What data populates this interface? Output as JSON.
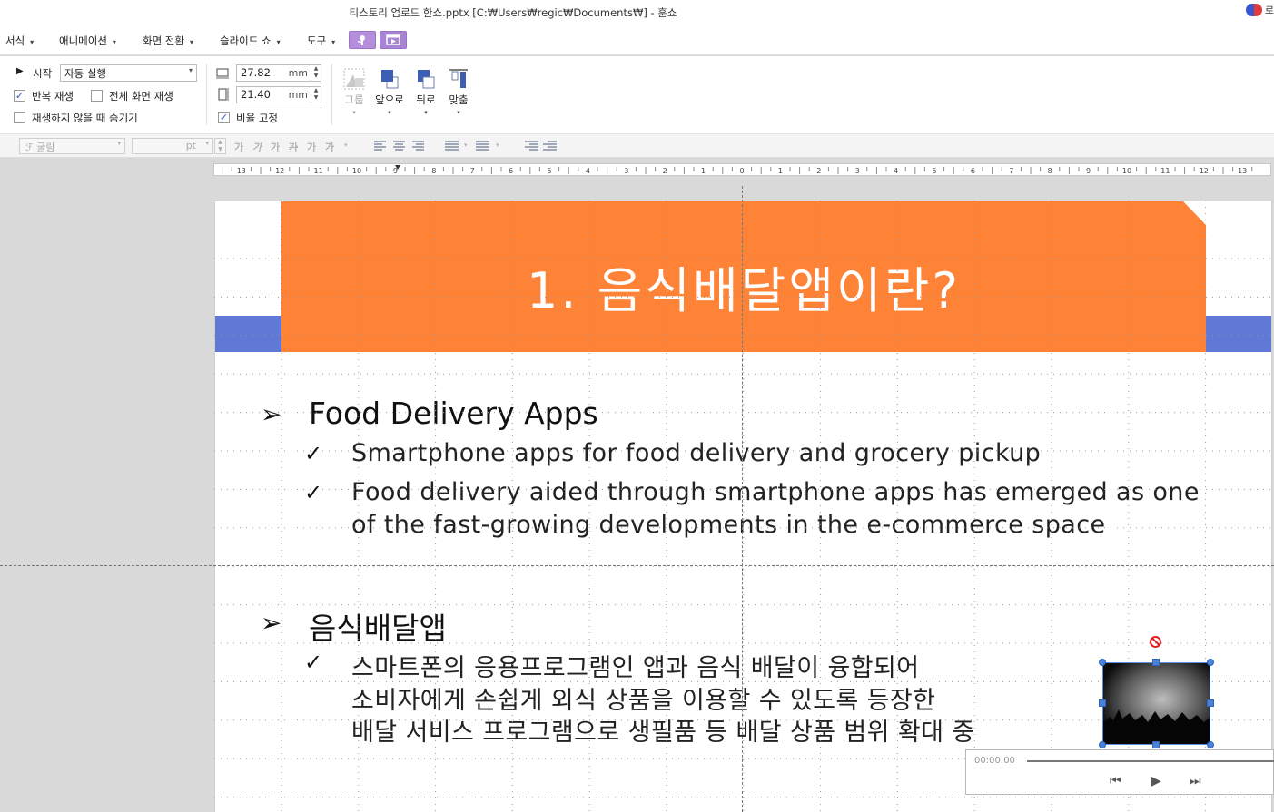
{
  "window": {
    "title": "티스토리 업로드 한쇼.pptx [C:₩Users₩regic₩Documents₩] - 훈쇼",
    "user_label": "로"
  },
  "menu": {
    "items": [
      "서식",
      "애니메이션",
      "화면 전환",
      "슬라이드 쇼",
      "도구"
    ]
  },
  "ribbon": {
    "start_label": "시작",
    "start_value": "자동 실행",
    "loop_label": "반복 재생",
    "loop_checked": true,
    "fullscreen_label": "전체 화면 재생",
    "fullscreen_checked": false,
    "hide_label": "재생하지 않을 때 숨기기",
    "hide_checked": false,
    "height_value": "27.82",
    "width_value": "21.40",
    "unit": "mm",
    "ratio_label": "비율 고정",
    "ratio_checked": true,
    "tools": {
      "group": "그룹",
      "front": "앞으로",
      "back": "뒤로",
      "fit": "맞춤"
    }
  },
  "formatbar": {
    "font_placeholder": "굴림",
    "size_unit": "pt",
    "glyphs": [
      "가",
      "가",
      "가",
      "가",
      "가",
      "가"
    ]
  },
  "ruler": {
    "left_ticks": [
      "13",
      "12",
      "11",
      "10",
      "9",
      "8",
      "7",
      "6",
      "5",
      "4",
      "3",
      "2",
      "1",
      "0"
    ],
    "right_ticks": [
      "1",
      "2",
      "3",
      "4",
      "5",
      "6",
      "7",
      "8",
      "9",
      "10",
      "11",
      "12",
      "13"
    ]
  },
  "slide": {
    "title": "1. 음식배달앱이란?",
    "section1": {
      "heading": "Food Delivery Apps",
      "bullets": [
        "Smartphone apps for food delivery and grocery pickup",
        "Food delivery aided through smartphone apps has emerged as one",
        "of the fast-growing developments in the e-commerce space"
      ]
    },
    "section2": {
      "heading": "음식배달앱",
      "bullets": [
        "스마트폰의 응용프로그램인 앱과 음식 배달이 융합되어",
        "소비자에게 손쉽게 외식 상품을 이용할 수 있도록 등장한",
        "배달 서비스 프로그램으로 생필품 등 배달 상품 범위 확대 중"
      ]
    },
    "bullet_glyph_arrow": "➢",
    "bullet_glyph_check": "✓"
  },
  "media": {
    "time": "00:00:00",
    "prev_glyph": "⏮",
    "play_glyph": "▶",
    "next_glyph": "⏭"
  },
  "colors": {
    "accent_orange": "#fe8337",
    "band_blue": "#6079d6",
    "menu_purple": "#b58fdc",
    "selection_blue": "#4a82db"
  }
}
